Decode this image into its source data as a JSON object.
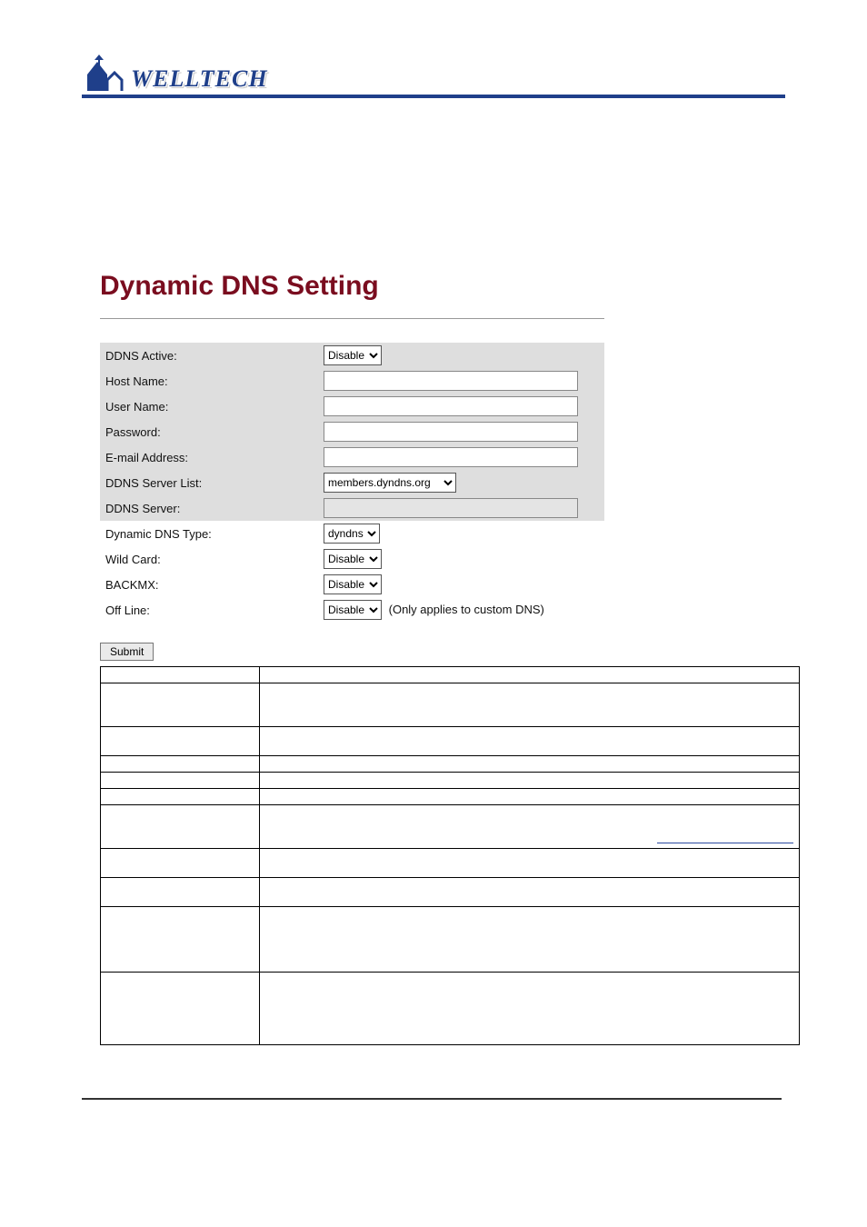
{
  "brand": "WELLTECH",
  "page_title": "Dynamic DNS Setting",
  "form": {
    "ddns_active": {
      "label": "DDNS Active:",
      "value": "Disable"
    },
    "host_name": {
      "label": "Host Name:",
      "value": ""
    },
    "user_name": {
      "label": "User Name:",
      "value": ""
    },
    "password": {
      "label": "Password:",
      "value": ""
    },
    "email": {
      "label": "E-mail Address:",
      "value": ""
    },
    "server_list": {
      "label": "DDNS Server List:",
      "value": "members.dyndns.org"
    },
    "ddns_server": {
      "label": "DDNS Server:",
      "value": ""
    },
    "dns_type": {
      "label": "Dynamic DNS Type:",
      "value": "dyndns"
    },
    "wild_card": {
      "label": "Wild Card:",
      "value": "Disable"
    },
    "backmx": {
      "label": "BACKMX:",
      "value": "Disable"
    },
    "off_line": {
      "label": "Off Line:",
      "value": "Disable",
      "note": "(Only applies to custom DNS)"
    }
  },
  "submit_label": "Submit"
}
